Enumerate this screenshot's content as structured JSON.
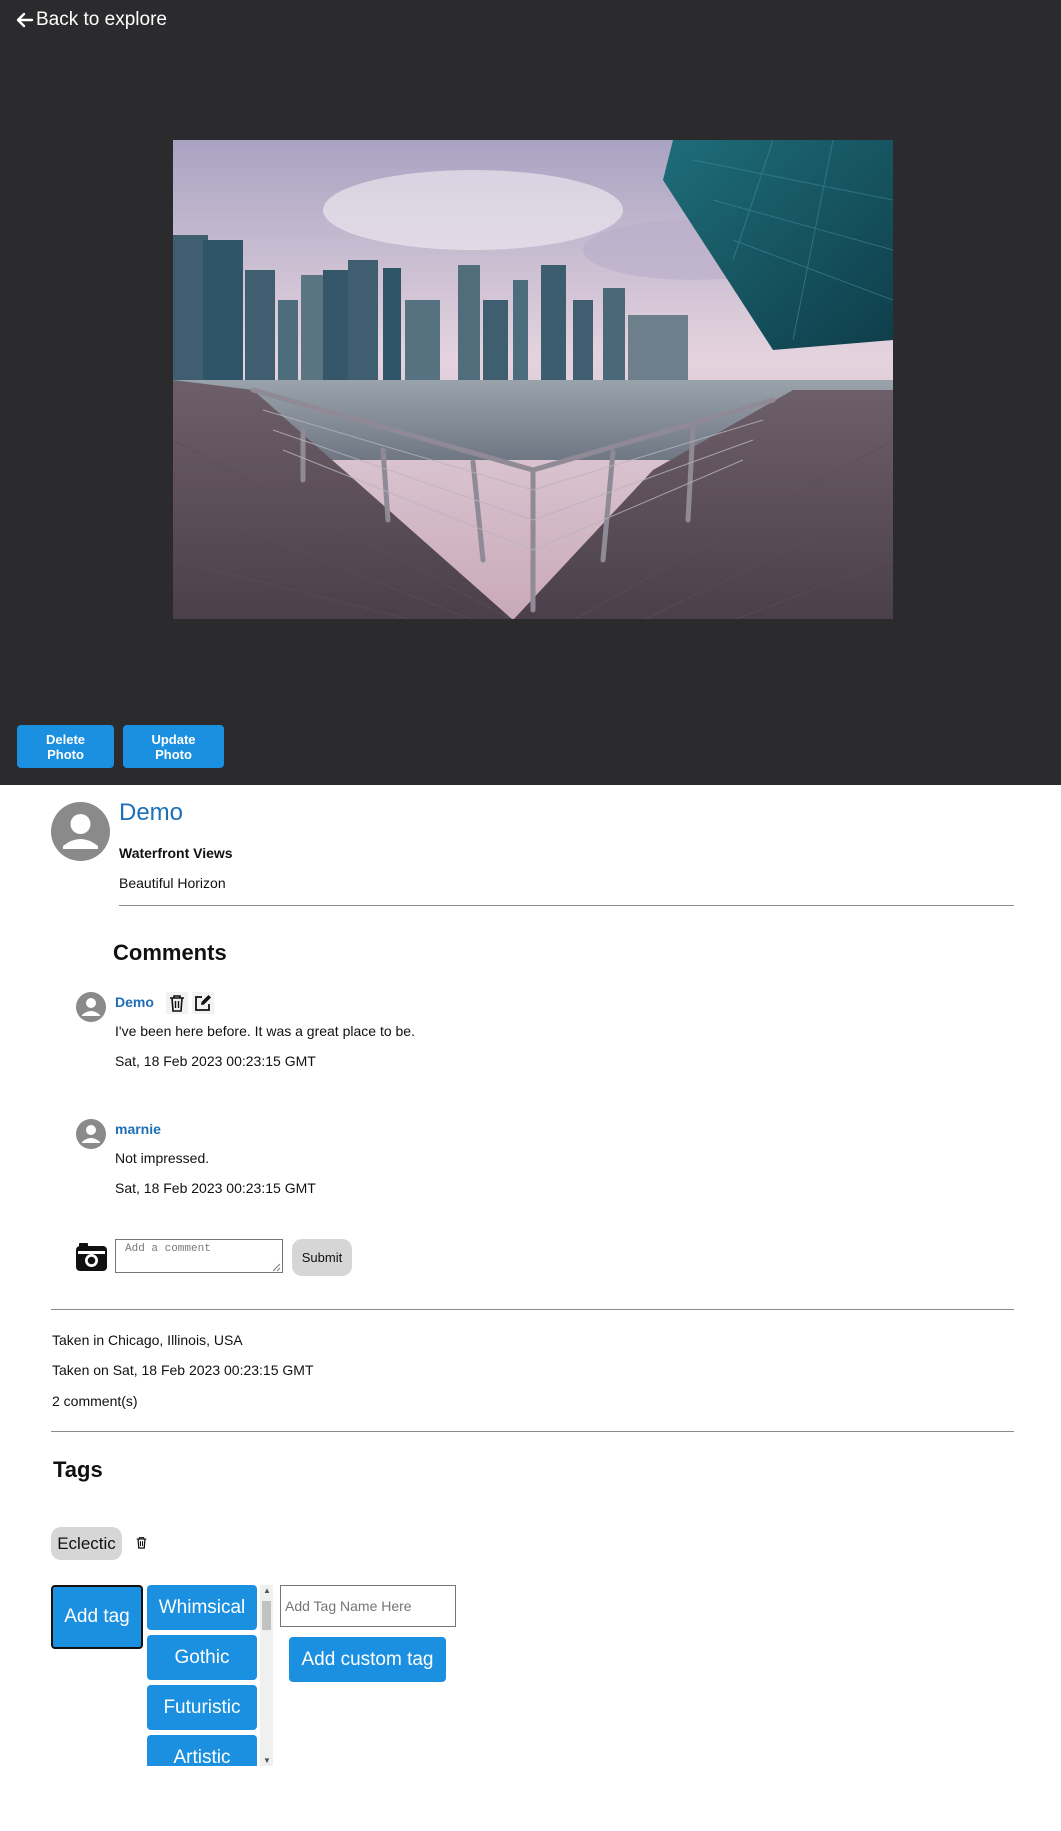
{
  "nav": {
    "back_label": "Back to explore"
  },
  "photo": {
    "alt": "Waterfront Views",
    "delete_label": "Delete Photo",
    "update_label": "Update Photo"
  },
  "owner": {
    "name": "Demo",
    "title": "Waterfront Views",
    "description": "Beautiful Horizon"
  },
  "comments": {
    "heading": "Comments",
    "items": [
      {
        "author": "Demo",
        "text": "I've been here before. It was a great place to be.",
        "date": "Sat, 18 Feb 2023 00:23:15 GMT"
      },
      {
        "author": "marnie",
        "text": "Not impressed.",
        "date": "Sat, 18 Feb 2023 00:23:15 GMT"
      }
    ],
    "input_placeholder": "Add a comment",
    "submit_label": "Submit"
  },
  "meta": {
    "location": "Taken in Chicago, Illinois, USA",
    "taken_on": "Taken on Sat, 18 Feb 2023 00:23:15 GMT",
    "comment_count": "2 comment(s)"
  },
  "tags": {
    "heading": "Tags",
    "current": [
      "Eclectic"
    ],
    "add_label": "Add tag",
    "options": [
      "Whimsical",
      "Gothic",
      "Futuristic",
      "Artistic"
    ],
    "custom_placeholder": "Add Tag Name Here",
    "custom_button_label": "Add custom tag"
  },
  "colors": {
    "hero_background": "#2b2b2d",
    "accent": "#1b8fe0",
    "link": "#1c6fb8",
    "chip": "#d6d6d6"
  }
}
